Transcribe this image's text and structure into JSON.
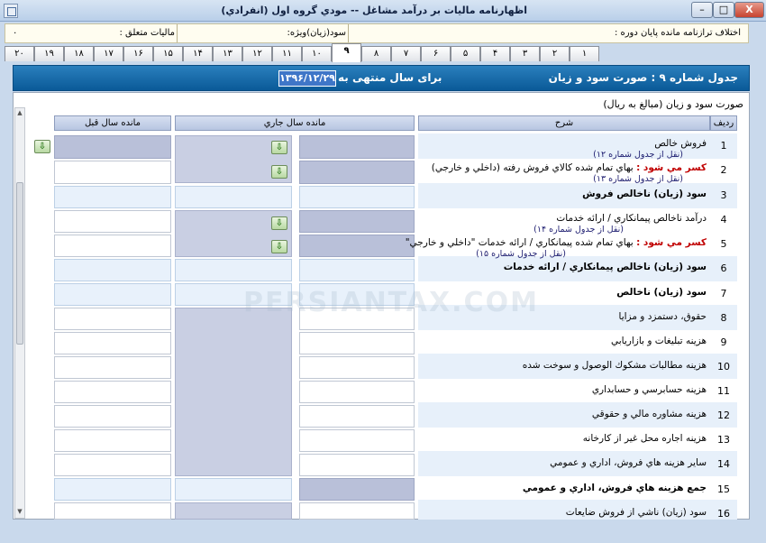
{
  "window": {
    "title": "اظهارنامه ماليات بر درآمد مشاغل -- مودي گروه اول (انفرادي)",
    "min_label": "–",
    "max_label": "□",
    "close_label": "X"
  },
  "info": {
    "diff_label": "اختلاف ترازنامه مانده پايان دوره :",
    "profit_label": "سود(زيان)ويژه:",
    "tax_label": "ماليات متعلق :",
    "tax_value": "۰"
  },
  "tabs": [
    "١",
    "٢",
    "٣",
    "۴",
    "۵",
    "۶",
    "٧",
    "٨",
    "٩",
    "١٠",
    "١١",
    "١٢",
    "١٣",
    "١۴",
    "١۵",
    "١۶",
    "١٧",
    "١٨",
    "١٩",
    "٢٠"
  ],
  "active_tab": "٩",
  "header": {
    "title": "جدول شماره ۹ : صورت سود و زيان",
    "year_label": "براى سال منتهى به",
    "date_value": "۱۳۹۶/۱۲/۲۹"
  },
  "panel": {
    "subtitle": "صورت سود و زيان (مبالغ به ريال)",
    "col_row": "رديف",
    "col_desc": "شرح",
    "col_current": "مانده سال جاري",
    "col_previous": "مانده سال قبل"
  },
  "watermark": "PERSIANTAX.COM",
  "rows": [
    {
      "num": "1",
      "main": "فروش خالص",
      "sub": "(نقل از جدول شماره ١٢)",
      "prefix": ""
    },
    {
      "num": "2",
      "main": "بهاي تمام شده كالاي فروش رفته (داخلي و خارجي)",
      "sub": "(نقل از جدول شماره ١٣)",
      "prefix": "كسر مي شود :"
    },
    {
      "num": "3",
      "main": "سود (زيان) ناخالص فروش",
      "sub": "",
      "prefix": ""
    },
    {
      "num": "4",
      "main": "درآمد ناخالص پيمانكاري / ارائه خدمات",
      "sub": "(نقل از جدول شماره ١۴)",
      "prefix": ""
    },
    {
      "num": "5",
      "main": "بهاي تمام شده پيمانكاري / ارائه خدمات \"داخلي و خارجي\"",
      "sub": "(نقل از جدول شماره ١۵)",
      "prefix": "كسر مي شود :"
    },
    {
      "num": "6",
      "main": "سود (زيان) ناخالص پيمانكاري / ارائه خدمات",
      "sub": "",
      "prefix": ""
    },
    {
      "num": "7",
      "main": "سود (زيان) ناخالص",
      "sub": "",
      "prefix": ""
    },
    {
      "num": "8",
      "main": "حقوق، دستمزد و مزايا",
      "sub": "",
      "prefix": ""
    },
    {
      "num": "9",
      "main": "هزينه تبليغات و بازاريابي",
      "sub": "",
      "prefix": ""
    },
    {
      "num": "10",
      "main": "هزينه مطالبات مشكوك الوصول و سوخت شده",
      "sub": "",
      "prefix": ""
    },
    {
      "num": "11",
      "main": "هزينه حسابرسي و حسابداري",
      "sub": "",
      "prefix": ""
    },
    {
      "num": "12",
      "main": "هزينه مشاوره مالي و حقوقي",
      "sub": "",
      "prefix": ""
    },
    {
      "num": "13",
      "main": "هزينه اجاره محل غير از كارخانه",
      "sub": "",
      "prefix": ""
    },
    {
      "num": "14",
      "main": "ساير هزينه هاي فروش، اداري و عمومي",
      "sub": "",
      "prefix": ""
    },
    {
      "num": "15",
      "main": "جمع هزينه هاي فروش، اداري و عمومي",
      "sub": "",
      "prefix": ""
    },
    {
      "num": "16",
      "main": "سود (زيان) ناشي از فروش ضايعات",
      "sub": "",
      "prefix": ""
    }
  ],
  "icons": {
    "app": "app-icon",
    "copy_arrow": "green-down-arrow-icon"
  }
}
